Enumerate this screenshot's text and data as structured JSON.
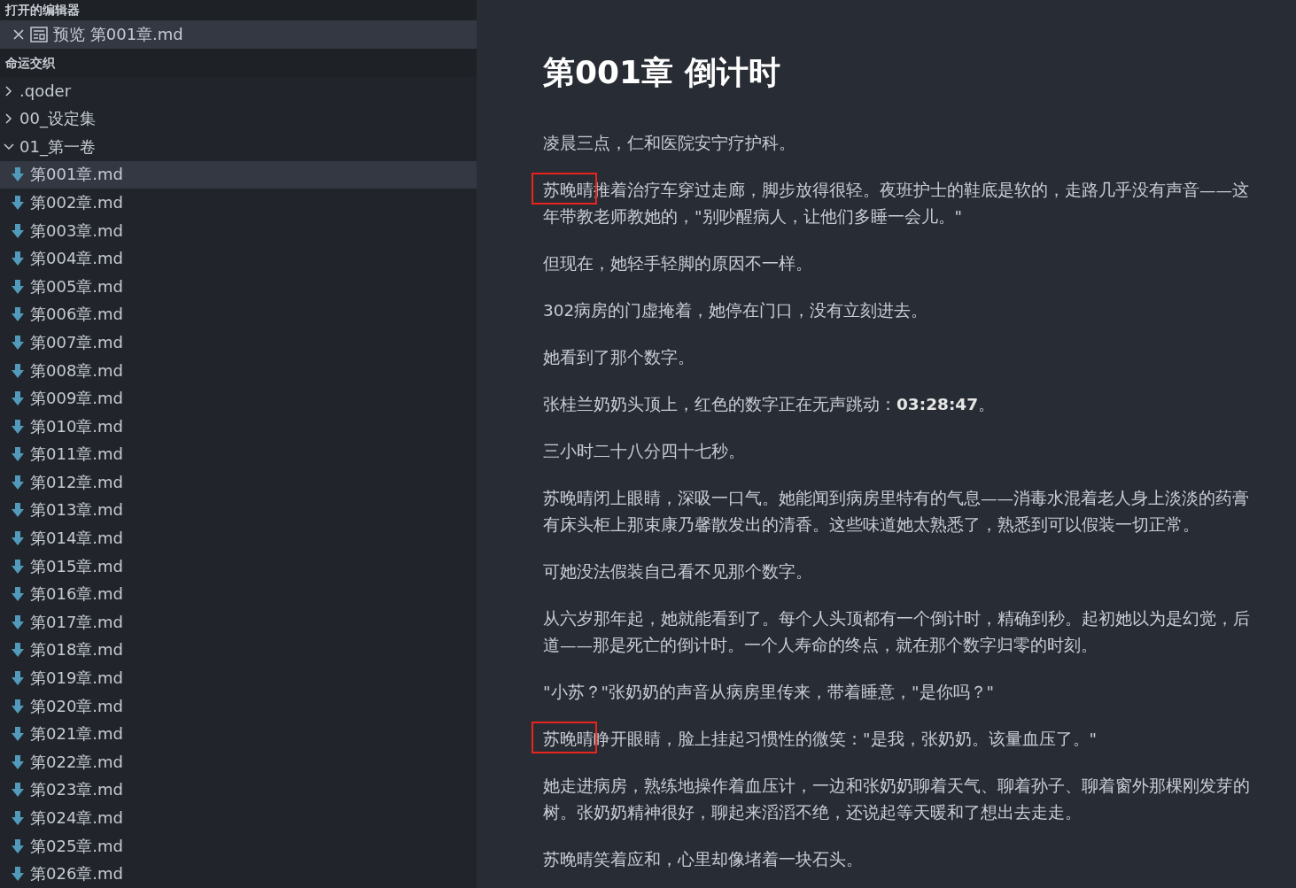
{
  "sidebar": {
    "open_editors": {
      "title": "打开的编辑器",
      "items": [
        {
          "prefix": "预览",
          "name": "第001章.md",
          "selected": true
        }
      ]
    },
    "workspace": {
      "title": "命运交织",
      "tree": [
        {
          "name": ".qoder",
          "kind": "folder",
          "expanded": false,
          "selected": false
        },
        {
          "name": "00_设定集",
          "kind": "folder",
          "expanded": false,
          "selected": false
        },
        {
          "name": "01_第一卷",
          "kind": "folder",
          "expanded": true,
          "selected": false,
          "children": [
            {
              "name": "第001章.md",
              "kind": "file",
              "selected": true
            },
            {
              "name": "第002章.md",
              "kind": "file",
              "selected": false
            },
            {
              "name": "第003章.md",
              "kind": "file",
              "selected": false
            },
            {
              "name": "第004章.md",
              "kind": "file",
              "selected": false
            },
            {
              "name": "第005章.md",
              "kind": "file",
              "selected": false
            },
            {
              "name": "第006章.md",
              "kind": "file",
              "selected": false
            },
            {
              "name": "第007章.md",
              "kind": "file",
              "selected": false
            },
            {
              "name": "第008章.md",
              "kind": "file",
              "selected": false
            },
            {
              "name": "第009章.md",
              "kind": "file",
              "selected": false
            },
            {
              "name": "第010章.md",
              "kind": "file",
              "selected": false
            },
            {
              "name": "第011章.md",
              "kind": "file",
              "selected": false
            },
            {
              "name": "第012章.md",
              "kind": "file",
              "selected": false
            },
            {
              "name": "第013章.md",
              "kind": "file",
              "selected": false
            },
            {
              "name": "第014章.md",
              "kind": "file",
              "selected": false
            },
            {
              "name": "第015章.md",
              "kind": "file",
              "selected": false
            },
            {
              "name": "第016章.md",
              "kind": "file",
              "selected": false
            },
            {
              "name": "第017章.md",
              "kind": "file",
              "selected": false
            },
            {
              "name": "第018章.md",
              "kind": "file",
              "selected": false
            },
            {
              "name": "第019章.md",
              "kind": "file",
              "selected": false
            },
            {
              "name": "第020章.md",
              "kind": "file",
              "selected": false
            },
            {
              "name": "第021章.md",
              "kind": "file",
              "selected": false
            },
            {
              "name": "第022章.md",
              "kind": "file",
              "selected": false
            },
            {
              "name": "第023章.md",
              "kind": "file",
              "selected": false
            },
            {
              "name": "第024章.md",
              "kind": "file",
              "selected": false
            },
            {
              "name": "第025章.md",
              "kind": "file",
              "selected": false
            },
            {
              "name": "第026章.md",
              "kind": "file",
              "selected": false
            }
          ]
        }
      ]
    }
  },
  "preview": {
    "title": "第001章 倒计时",
    "paragraphs": [
      {
        "lines": [
          "凌晨三点，仁和医院安宁疗护科。"
        ],
        "annotated": false
      },
      {
        "lines": [
          "苏晚晴推着治疗车穿过走廊，脚步放得很轻。夜班护士的鞋底是软的，走路几乎没有声音——这",
          "年带教老师教她的，\"别吵醒病人，让他们多睡一会儿。\""
        ],
        "annotated": true
      },
      {
        "lines": [
          "但现在，她轻手轻脚的原因不一样。"
        ],
        "annotated": false
      },
      {
        "lines": [
          "302病房的门虚掩着，她停在门口，没有立刻进去。"
        ],
        "annotated": false
      },
      {
        "lines": [
          "她看到了那个数字。"
        ],
        "annotated": false
      },
      {
        "lines": [
          "张桂兰奶奶头顶上，红色的数字正在无声跳动：**03:28:47**。"
        ],
        "annotated": false
      },
      {
        "lines": [
          "三小时二十八分四十七秒。"
        ],
        "annotated": false
      },
      {
        "lines": [
          "苏晚晴闭上眼睛，深吸一口气。她能闻到病房里特有的气息——消毒水混着老人身上淡淡的药膏",
          "有床头柜上那束康乃馨散发出的清香。这些味道她太熟悉了，熟悉到可以假装一切正常。"
        ],
        "annotated": false
      },
      {
        "lines": [
          "可她没法假装自己看不见那个数字。"
        ],
        "annotated": false
      },
      {
        "lines": [
          "从六岁那年起，她就能看到了。每个人头顶都有一个倒计时，精确到秒。起初她以为是幻觉，后",
          "道——那是死亡的倒计时。一个人寿命的终点，就在那个数字归零的时刻。"
        ],
        "annotated": false
      },
      {
        "lines": [
          "\"小苏？\"张奶奶的声音从病房里传来，带着睡意，\"是你吗？\""
        ],
        "annotated": false
      },
      {
        "lines": [
          "苏晚晴睁开眼睛，脸上挂起习惯性的微笑：\"是我，张奶奶。该量血压了。\""
        ],
        "annotated": true
      },
      {
        "lines": [
          "她走进病房，熟练地操作着血压计，一边和张奶奶聊着天气、聊着孙子、聊着窗外那棵刚发芽的",
          "树。张奶奶精神很好，聊起来滔滔不绝，还说起等天暖和了想出去走走。"
        ],
        "annotated": false
      },
      {
        "lines": [
          "苏晚晴笑着应和，心里却像堵着一块石头。"
        ],
        "annotated": false
      }
    ]
  }
}
